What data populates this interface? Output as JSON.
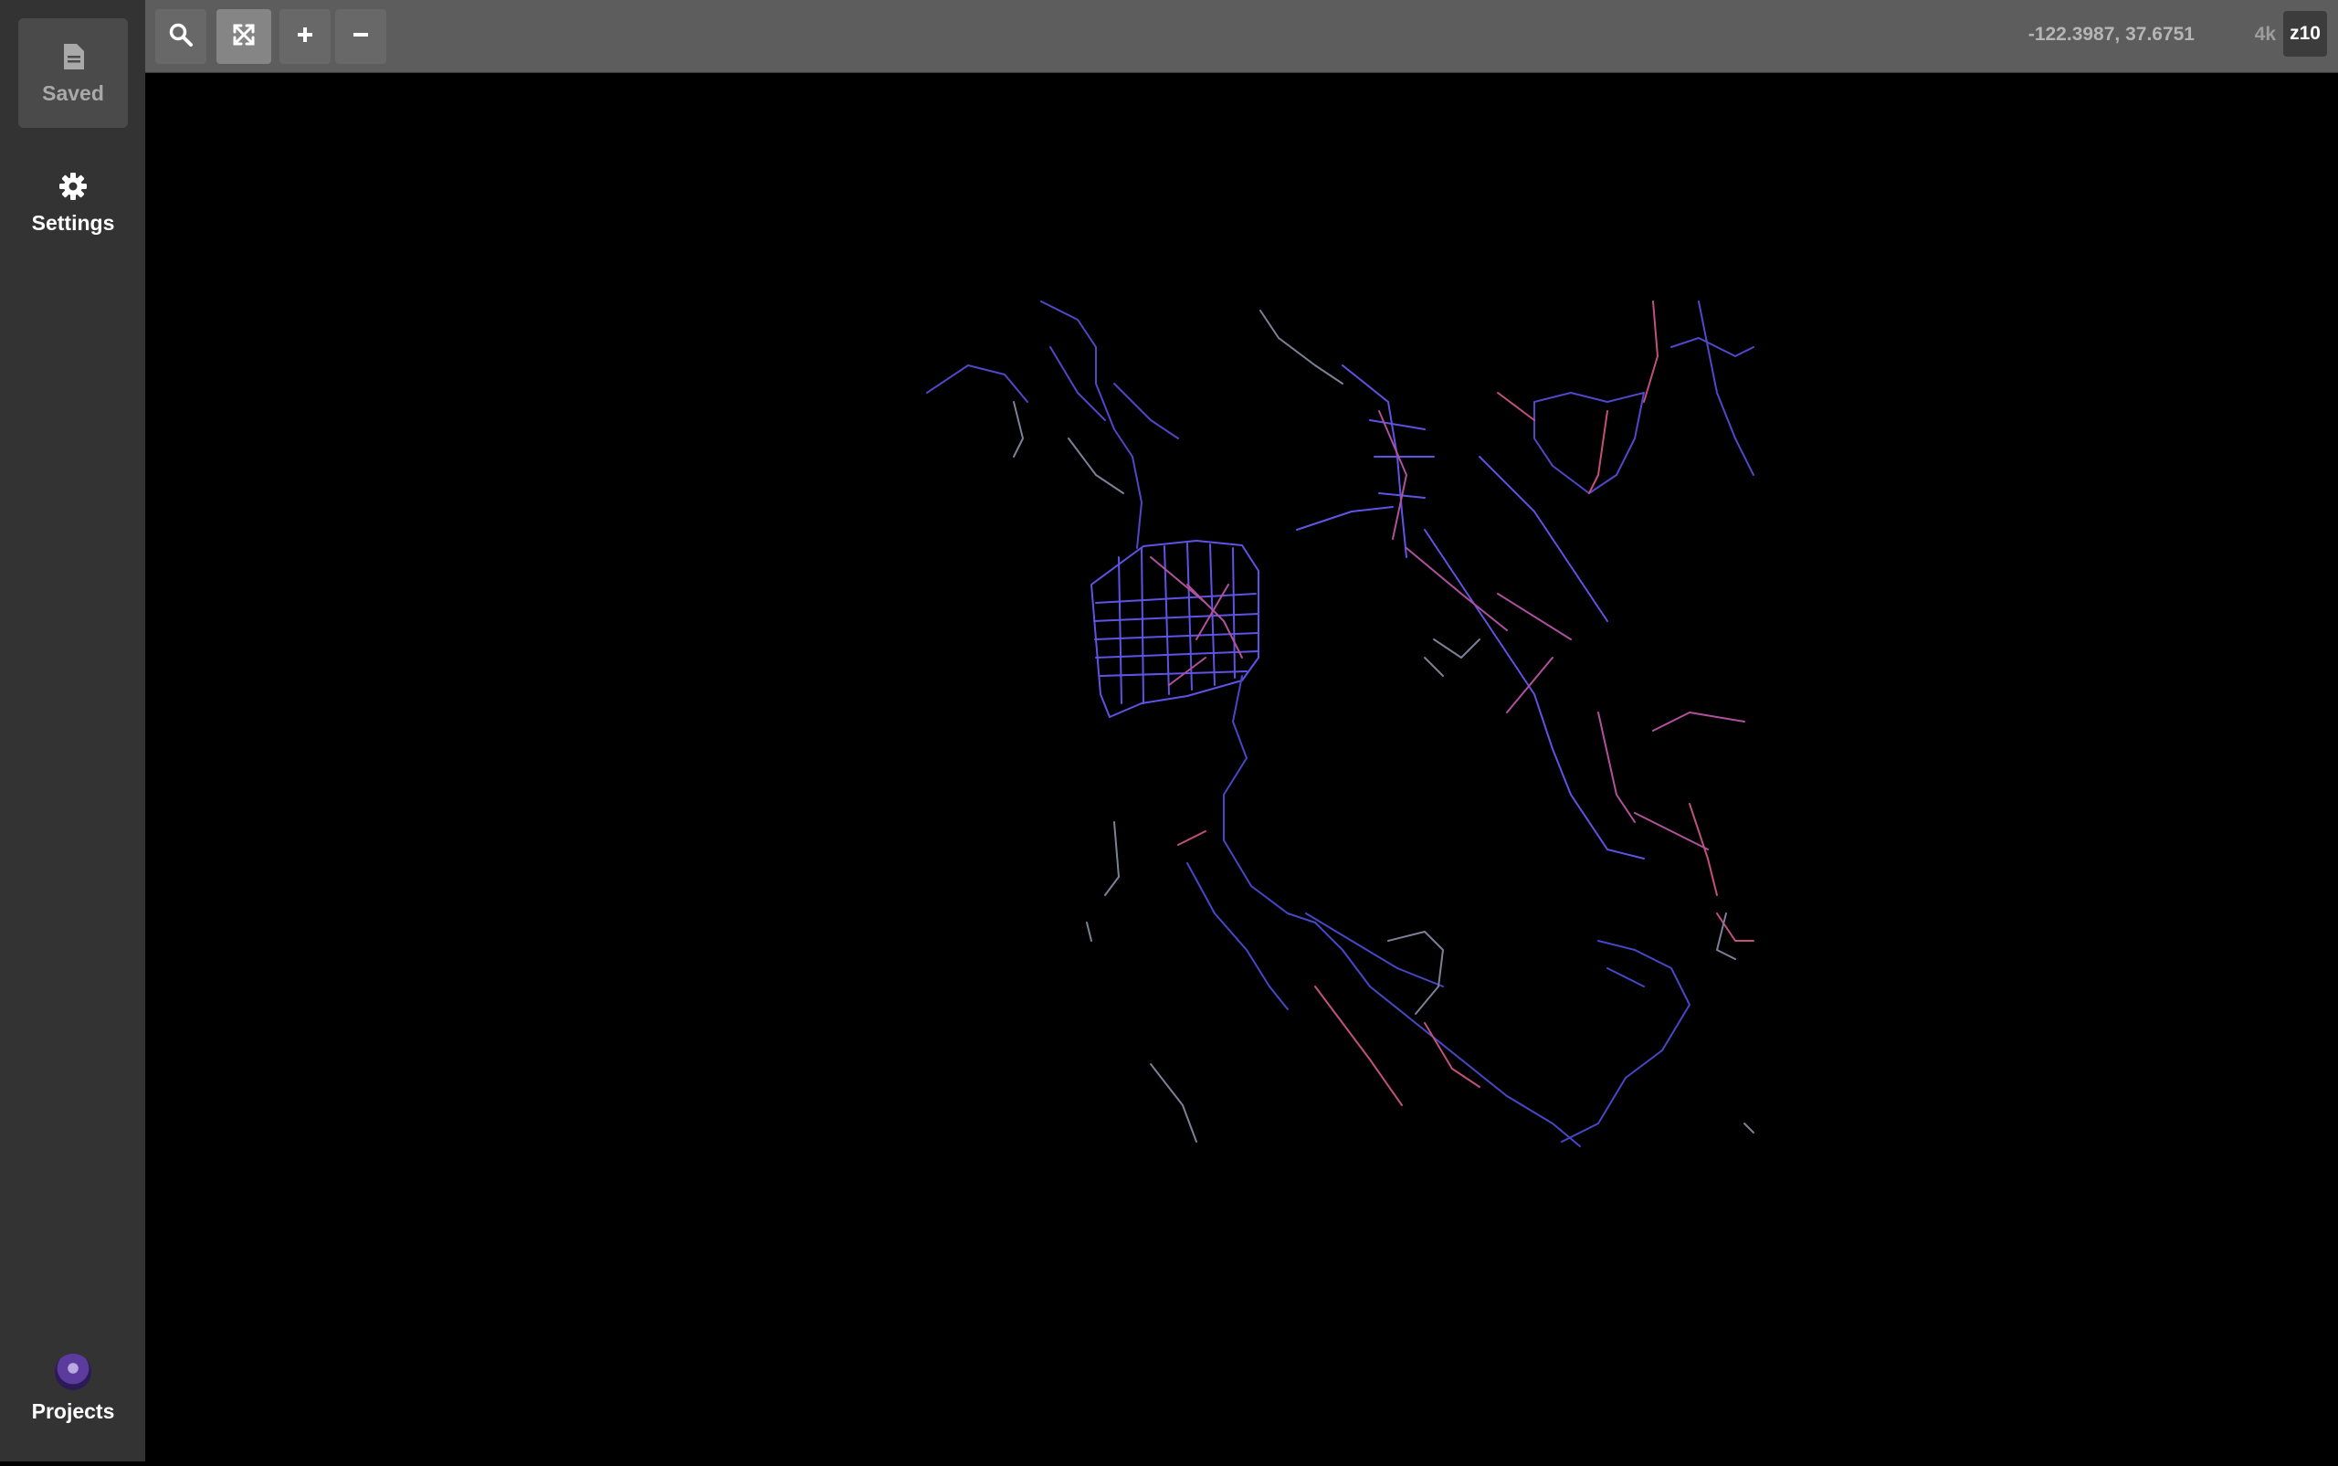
{
  "sidebar": {
    "saved_label": "Saved",
    "settings_label": "Settings",
    "projects_label": "Projects",
    "saved_icon": "document-icon",
    "settings_icon": "gear-icon",
    "projects_icon": "avatar"
  },
  "toolbar": {
    "buttons": [
      "search-icon",
      "fit-bounds-icon",
      "zoom-in-icon",
      "zoom-out-icon"
    ],
    "coordinates": "-122.3987, 37.6751",
    "resolution": "4k",
    "zoom": "z10"
  },
  "map": {
    "background": "#000000",
    "route_colors": [
      "#4a4aff",
      "#7b6bff",
      "#c45ab0",
      "#8a8fa8",
      "#d65a8a"
    ]
  }
}
